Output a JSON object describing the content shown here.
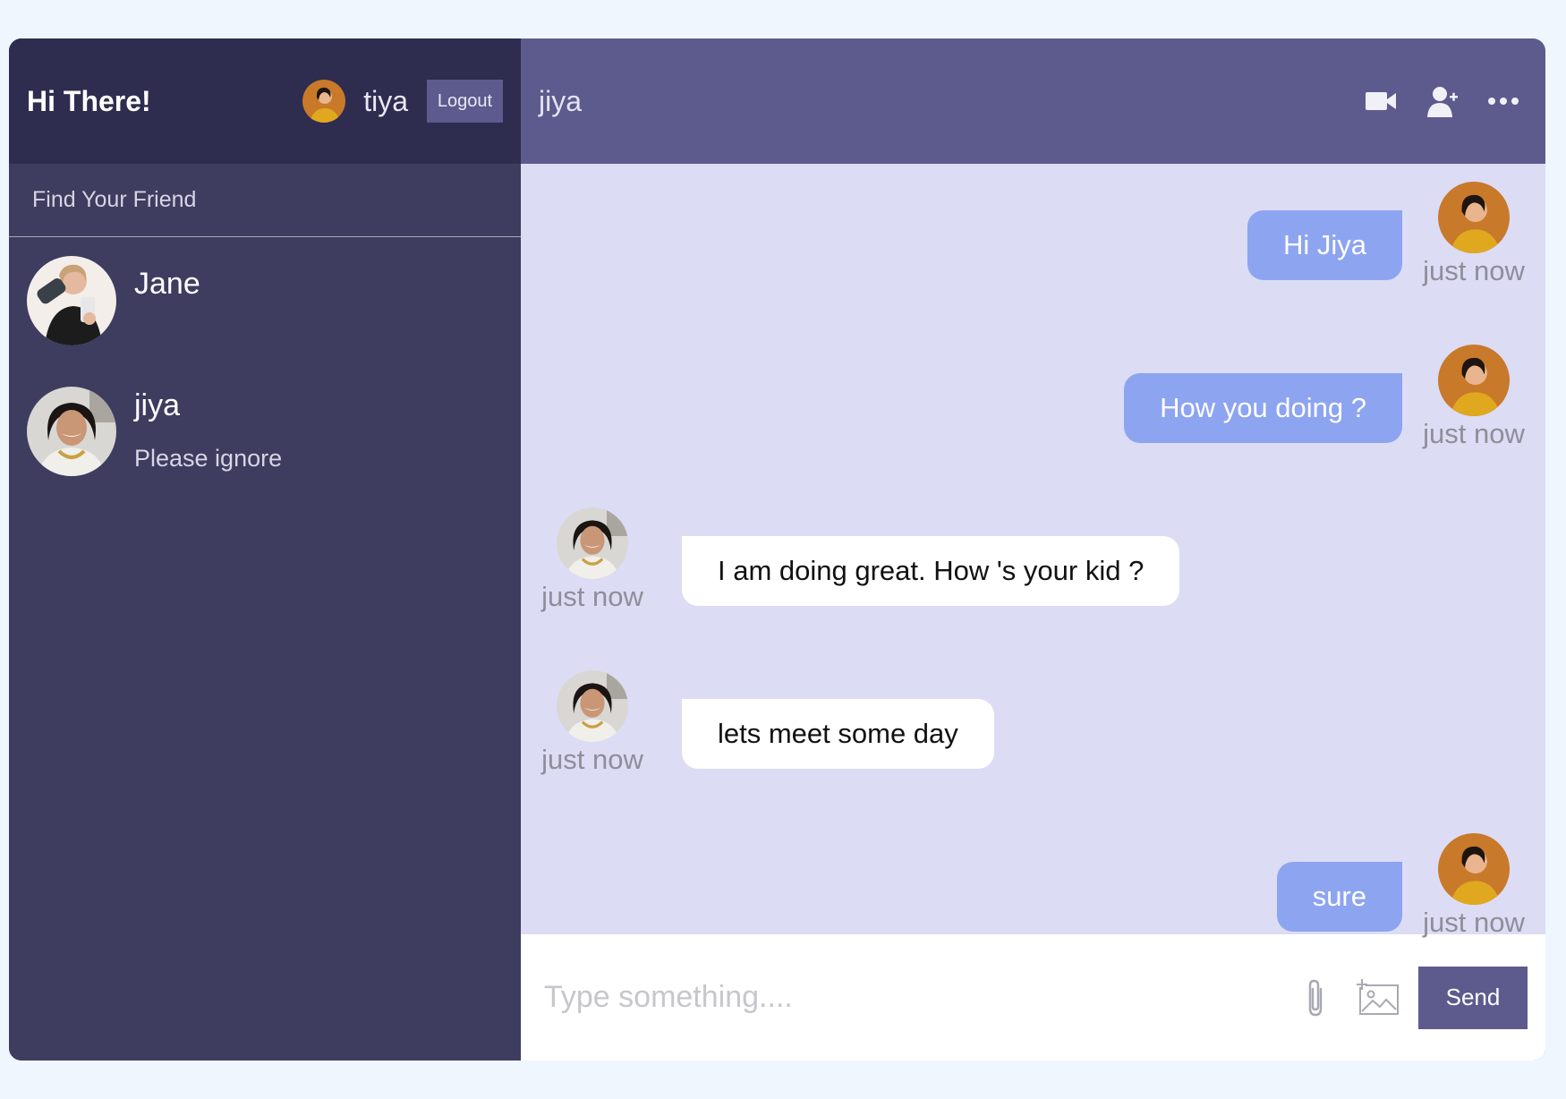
{
  "sidebar": {
    "title": "Hi There!",
    "current_user": {
      "name": "tiya",
      "avatar": "avatar-tiya"
    },
    "logout_label": "Logout",
    "search": {
      "placeholder": "Find Your Friend",
      "value": ""
    },
    "chats": [
      {
        "name": "Jane",
        "last_message": "",
        "avatar": "avatar-jane"
      },
      {
        "name": "jiya",
        "last_message": "Please ignore",
        "avatar": "avatar-jiya"
      }
    ]
  },
  "chat": {
    "title": "jiya",
    "header_icons": [
      "video-camera-icon",
      "add-user-icon",
      "more-options-icon"
    ],
    "messages": [
      {
        "sender": "owner",
        "text": "Hi Jiya",
        "time": "just now"
      },
      {
        "sender": "owner",
        "text": "How you doing ?",
        "time": "just now"
      },
      {
        "sender": "other",
        "text": "I am doing great. How 's your kid ?",
        "time": "just now"
      },
      {
        "sender": "other",
        "text": "lets meet some day",
        "time": "just now"
      },
      {
        "sender": "owner",
        "text": "sure",
        "time": "just now"
      }
    ],
    "input": {
      "placeholder": "Type something....",
      "value": ""
    },
    "tool_icons": [
      "paperclip-icon",
      "add-image-icon"
    ],
    "send_label": "Send"
  },
  "colors": {
    "page_bg": "#f0f6fd",
    "sidebar_bg": "#3e3c5f",
    "sidebar_header_bg": "#2e2c4f",
    "chat_header_bg": "#5d5b8d",
    "messages_bg": "#dcdcf5",
    "owner_bubble": "#8da4f1",
    "other_bubble": "#ffffff"
  }
}
